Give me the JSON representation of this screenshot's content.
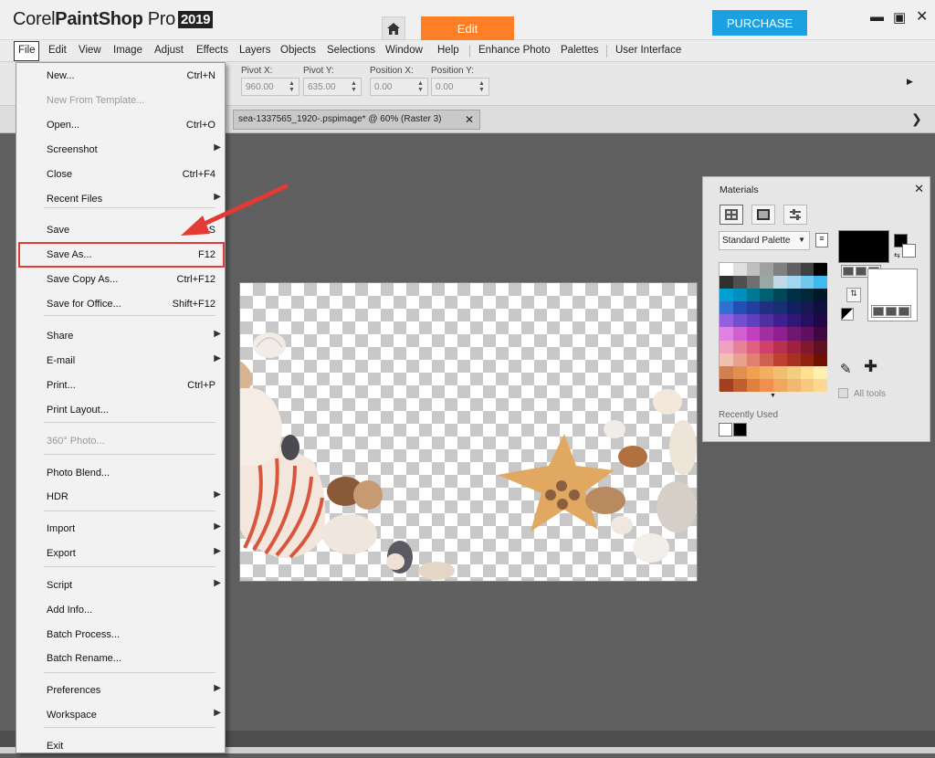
{
  "app": {
    "brand_prefix": "Corel",
    "brand_name": "PaintShop",
    "brand_suffix": "Pro",
    "brand_year": "2019"
  },
  "header": {
    "edit_tab": "Edit",
    "purchase_button": "PURCHASE"
  },
  "menubar": {
    "items": [
      "File",
      "Edit",
      "View",
      "Image",
      "Adjust",
      "Effects",
      "Layers",
      "Objects",
      "Selections",
      "Window",
      "Help",
      "Enhance Photo",
      "Palettes",
      "User Interface"
    ]
  },
  "options": {
    "pivot_x": {
      "label": "Pivot X:",
      "value": "960.00"
    },
    "pivot_y": {
      "label": "Pivot Y:",
      "value": "635.00"
    },
    "position_x": {
      "label": "Position X:",
      "value": "0.00"
    },
    "position_y": {
      "label": "Position Y:",
      "value": "0.00"
    }
  },
  "document_tab": {
    "title": "sea-1337565_1920-.pspimage* @  60% (Raster 3)"
  },
  "file_menu": {
    "items": [
      {
        "label": "New...",
        "shortcut": "Ctrl+N"
      },
      {
        "label": "New From Template...",
        "shortcut": "",
        "disabled": true
      },
      {
        "label": "Open...",
        "shortcut": "Ctrl+O"
      },
      {
        "label": "Screenshot",
        "submenu": true
      },
      {
        "label": "Close",
        "shortcut": "Ctrl+F4"
      },
      {
        "label": "Recent Files",
        "submenu": true
      },
      {
        "label": "Save",
        "shortcut": "S"
      },
      {
        "label": "Save As...",
        "shortcut": "F12"
      },
      {
        "label": "Save Copy As...",
        "shortcut": "Ctrl+F12"
      },
      {
        "label": "Save for Office...",
        "shortcut": "Shift+F12"
      },
      {
        "label": "Share",
        "submenu": true
      },
      {
        "label": "E-mail",
        "submenu": true
      },
      {
        "label": "Print...",
        "shortcut": "Ctrl+P"
      },
      {
        "label": "Print Layout...",
        "shortcut": ""
      },
      {
        "label": "360° Photo...",
        "shortcut": "",
        "disabled": true
      },
      {
        "label": "Photo Blend...",
        "shortcut": ""
      },
      {
        "label": "HDR",
        "submenu": true
      },
      {
        "label": "Import",
        "submenu": true
      },
      {
        "label": "Export",
        "submenu": true
      },
      {
        "label": "Script",
        "submenu": true
      },
      {
        "label": "Add Info...",
        "shortcut": ""
      },
      {
        "label": "Batch Process...",
        "shortcut": ""
      },
      {
        "label": "Batch Rename...",
        "shortcut": ""
      },
      {
        "label": "Preferences",
        "submenu": true
      },
      {
        "label": "Workspace",
        "submenu": true
      },
      {
        "label": "Exit",
        "shortcut": ""
      }
    ]
  },
  "materials": {
    "title": "Materials",
    "palette_select": "Standard Palette",
    "recently_used": "Recently Used",
    "all_tools": "All tools",
    "swatches": [
      "#ffffff",
      "#e0e0e0",
      "#c0c0c0",
      "#a0a0a0",
      "#808080",
      "#606060",
      "#404040",
      "#000000",
      "#303030",
      "#505050",
      "#707070",
      "#9aa7a7",
      "#c0d8e8",
      "#a0d8f0",
      "#70c8f0",
      "#40b8f0",
      "#00a0d0",
      "#0090c0",
      "#007890",
      "#006070",
      "#004858",
      "#003048",
      "#002838",
      "#001828",
      "#3070d0",
      "#2050b0",
      "#2040a0",
      "#203080",
      "#183070",
      "#102060",
      "#181850",
      "#101040",
      "#9060e0",
      "#7050d0",
      "#6040c0",
      "#5030a0",
      "#402090",
      "#301878",
      "#281060",
      "#200848",
      "#e080e0",
      "#d060d0",
      "#c040c0",
      "#a030a0",
      "#902090",
      "#701870",
      "#601060",
      "#400840",
      "#f0a0c0",
      "#e88098",
      "#e06080",
      "#d04068",
      "#b83050",
      "#a02040",
      "#801830",
      "#601020",
      "#f0c0b0",
      "#e8a090",
      "#e08070",
      "#d06050",
      "#c04030",
      "#a83020",
      "#902010",
      "#701000",
      "#d08050",
      "#e09050",
      "#f0a050",
      "#f0b060",
      "#f0c070",
      "#f0d080",
      "#ffe090",
      "#fff0b0",
      "#a04020",
      "#c06030",
      "#e08040",
      "#f09050",
      "#f0a860",
      "#f0b870",
      "#f8c880",
      "#ffd890"
    ]
  }
}
